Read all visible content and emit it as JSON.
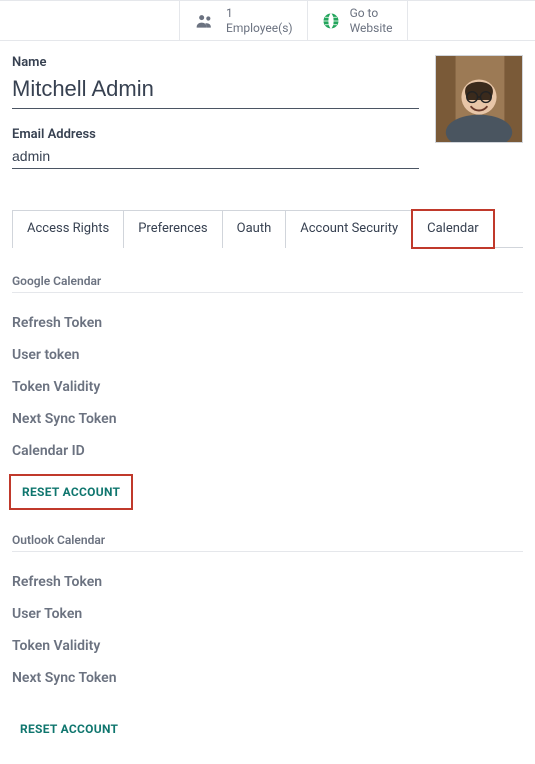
{
  "topbar": {
    "employees": {
      "count": "1",
      "label": "Employee(s)"
    },
    "website": {
      "line1": "Go to",
      "line2": "Website"
    }
  },
  "form": {
    "name_label": "Name",
    "name_value": "Mitchell Admin",
    "email_label": "Email Address",
    "email_value": "admin"
  },
  "tabs": [
    {
      "label": "Access Rights"
    },
    {
      "label": "Preferences"
    },
    {
      "label": "Oauth"
    },
    {
      "label": "Account Security"
    },
    {
      "label": "Calendar"
    }
  ],
  "google": {
    "title": "Google Calendar",
    "fields": [
      "Refresh Token",
      "User token",
      "Token Validity",
      "Next Sync Token",
      "Calendar ID"
    ],
    "reset_label": "RESET ACCOUNT"
  },
  "outlook": {
    "title": "Outlook Calendar",
    "fields": [
      "Refresh Token",
      "User Token",
      "Token Validity",
      "Next Sync Token"
    ],
    "reset_label": "RESET ACCOUNT"
  }
}
